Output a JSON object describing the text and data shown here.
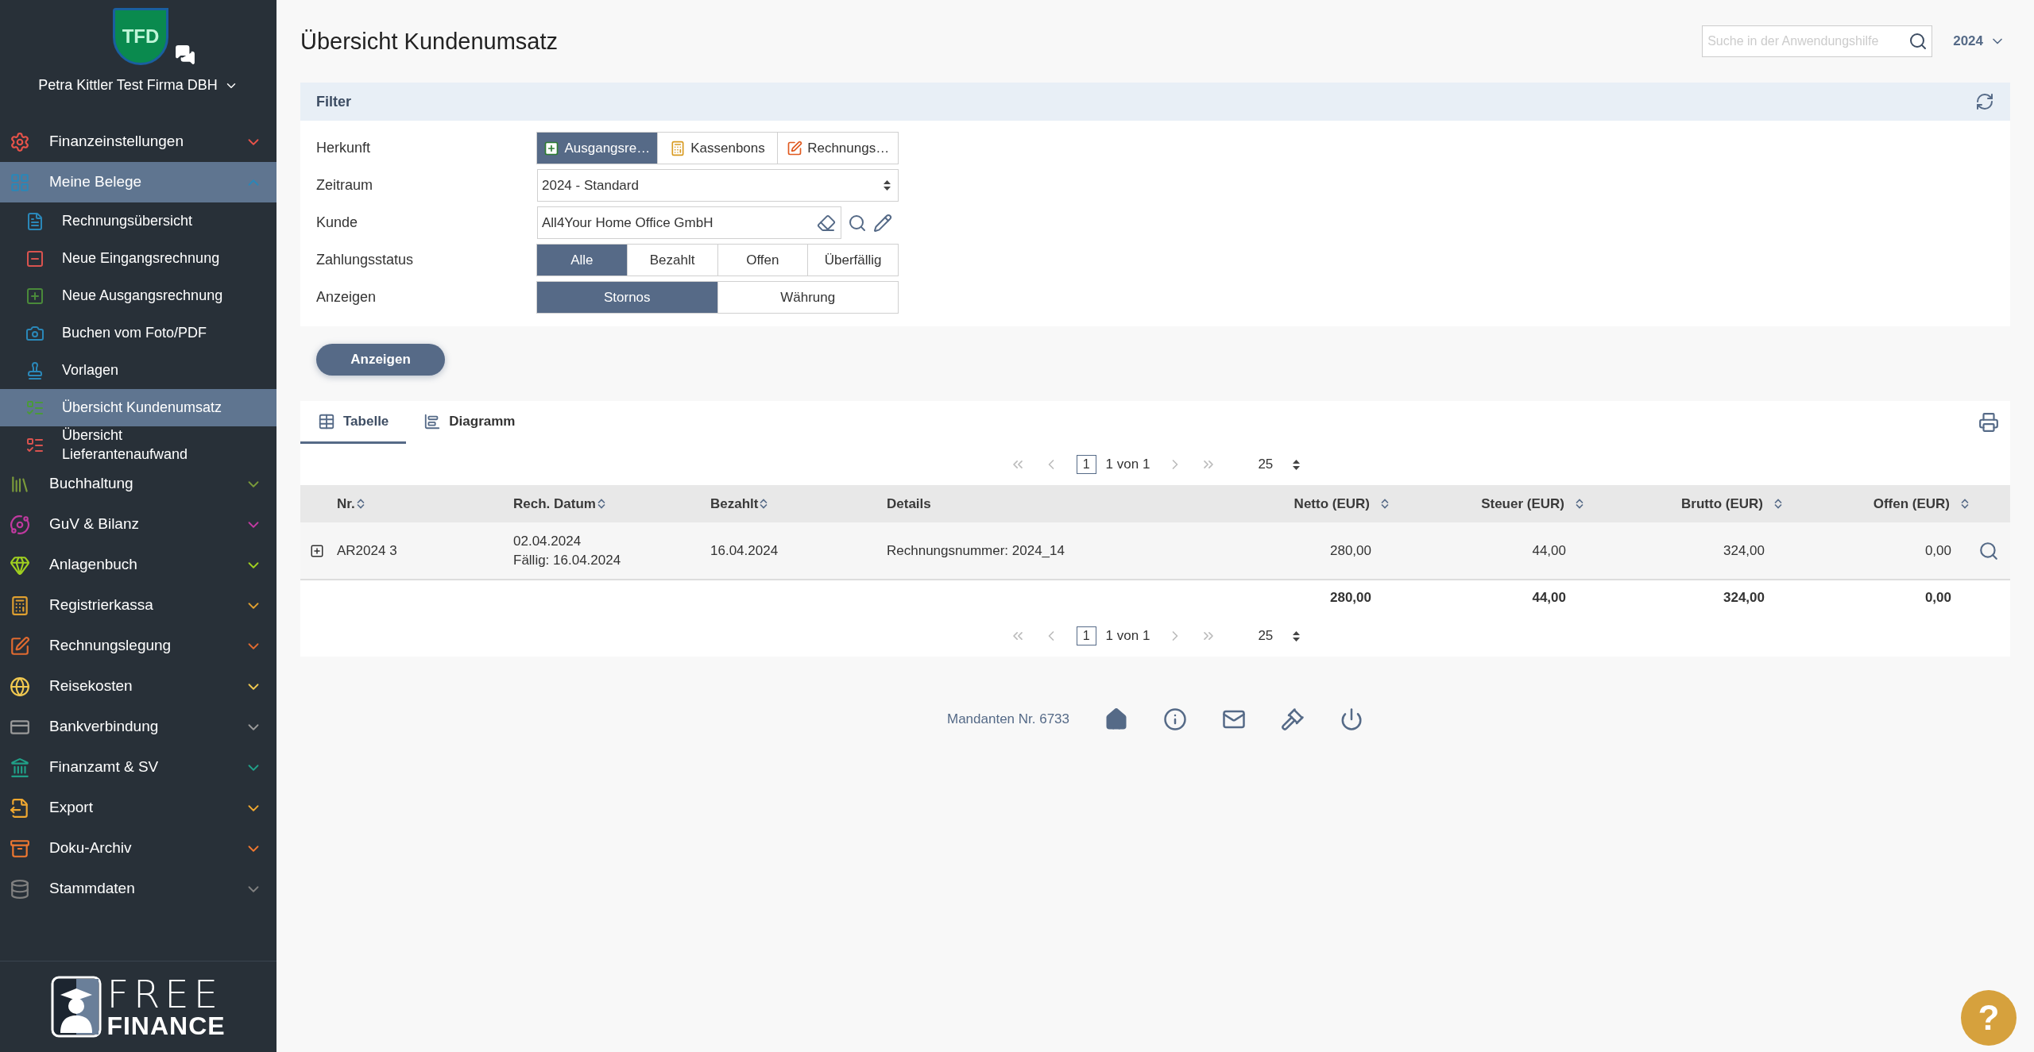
{
  "sidebar": {
    "avatar": "TFD",
    "company": "Petra Kittler Test Firma DBH",
    "items": [
      {
        "label": "Finanzeinstellungen",
        "color": "#e8534a",
        "selected": false,
        "expanded": false
      },
      {
        "label": "Meine Belege",
        "color": "#2a87b8",
        "selected": true,
        "expanded": true,
        "children": [
          {
            "label": "Rechnungsübersicht",
            "color": "#2a87b8",
            "selected": false
          },
          {
            "label": "Neue Eingangsrechnung",
            "color": "#d9534f",
            "selected": false
          },
          {
            "label": "Neue Ausgangsrechnung",
            "color": "#4a8a3a",
            "selected": false
          },
          {
            "label": "Buchen vom Foto/PDF",
            "color": "#2a87b8",
            "selected": false
          },
          {
            "label": "Vorlagen",
            "color": "#2a87b8",
            "selected": false
          },
          {
            "label": "Übersicht Kundenumsatz",
            "color": "#4a9a3a",
            "selected": true
          },
          {
            "label": "Übersicht Lieferantenaufwand",
            "color": "#d9534f",
            "selected": false
          }
        ]
      },
      {
        "label": "Buchhaltung",
        "color": "#7a9a3a",
        "selected": false,
        "expanded": false
      },
      {
        "label": "GuV & Bilanz",
        "color": "#c03aa0",
        "selected": false,
        "expanded": false
      },
      {
        "label": "Anlagenbuch",
        "color": "#a0d020",
        "selected": false,
        "expanded": false
      },
      {
        "label": "Registrierkassa",
        "color": "#e0a030",
        "selected": false,
        "expanded": false
      },
      {
        "label": "Rechnungslegung",
        "color": "#e06a30",
        "selected": false,
        "expanded": false
      },
      {
        "label": "Reisekosten",
        "color": "#f0c850",
        "selected": false,
        "expanded": false
      },
      {
        "label": "Bankverbindung",
        "color": "#9a9a9a",
        "selected": false,
        "expanded": false
      },
      {
        "label": "Finanzamt & SV",
        "color": "#20a088",
        "selected": false,
        "expanded": false
      },
      {
        "label": "Export",
        "color": "#f0a830",
        "selected": false,
        "expanded": false
      },
      {
        "label": "Doku-Archiv",
        "color": "#f07830",
        "selected": false,
        "expanded": false
      },
      {
        "label": "Stammdaten",
        "color": "#808080",
        "selected": false,
        "expanded": false
      }
    ],
    "logo": {
      "line1": "FREE",
      "line2": "FINANCE"
    }
  },
  "page_title": "Übersicht Kundenumsatz",
  "help_search": {
    "placeholder": "Suche in der Anwendungshilfe"
  },
  "year_select": "2024",
  "filter": {
    "title": "Filter",
    "rows": [
      {
        "label": "Herkunft",
        "kind": "toggles",
        "options": [
          {
            "label": "Ausgangsre…",
            "selected": true
          },
          {
            "label": "Kassenbons",
            "selected": false
          },
          {
            "label": "Rechnungs…",
            "selected": false
          }
        ]
      },
      {
        "label": "Zeitraum",
        "kind": "select",
        "value": "2024 - Standard"
      },
      {
        "label": "Kunde",
        "kind": "lookup",
        "value": "All4Your Home Office GmbH"
      },
      {
        "label": "Zahlungsstatus",
        "kind": "toggles",
        "options": [
          {
            "label": "Alle",
            "selected": true
          },
          {
            "label": "Bezahlt",
            "selected": false
          },
          {
            "label": "Offen",
            "selected": false
          },
          {
            "label": "Überfällig",
            "selected": false
          }
        ]
      },
      {
        "label": "Anzeigen",
        "kind": "toggles",
        "options": [
          {
            "label": "Stornos",
            "selected": true
          },
          {
            "label": "Währung",
            "selected": false
          }
        ]
      }
    ]
  },
  "submit": "Anzeigen",
  "tabs": [
    {
      "label": "Tabelle",
      "selected": true
    },
    {
      "label": "Diagramm",
      "selected": false
    }
  ],
  "pager_top": {
    "page": "1",
    "of": "1 von 1",
    "size": "25"
  },
  "table": {
    "columns": [
      {
        "label": "Nr.",
        "sortable": true
      },
      {
        "label": "Rech. Datum",
        "sortable": true
      },
      {
        "label": "Bezahlt",
        "sortable": true
      },
      {
        "label": "Details",
        "sortable": false
      },
      {
        "label": "Netto (EUR)",
        "sortable": true
      },
      {
        "label": "Steuer (EUR)",
        "sortable": true
      },
      {
        "label": "Brutto (EUR)",
        "sortable": true
      },
      {
        "label": "Offen (EUR)",
        "sortable": true
      }
    ],
    "rows": [
      {
        "expanded": false,
        "nr": "AR2024 3",
        "date": "02.04.2024",
        "due": "Fällig: 16.04.2024",
        "paid": "16.04.2024",
        "details": "Rechnungsnummer: 2024_14",
        "amounts": [
          "280,00",
          "44,00",
          "324,00",
          "0,00"
        ]
      }
    ],
    "totals": [
      "280,00",
      "44,00",
      "324,00",
      "0,00"
    ]
  },
  "pager_bottom": {
    "page": "1",
    "of": "1 von 1",
    "size": "25"
  },
  "footer": {
    "client": "Mandanten Nr. 6733"
  },
  "help_button": "?"
}
